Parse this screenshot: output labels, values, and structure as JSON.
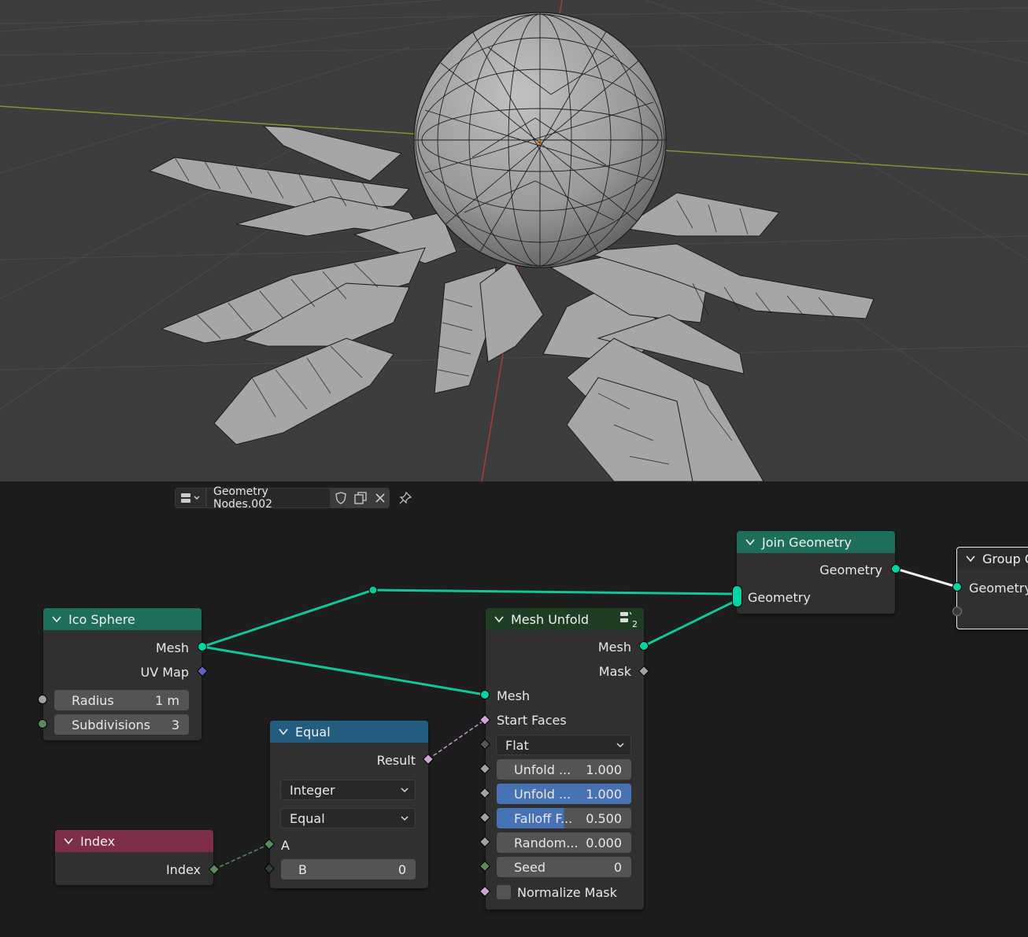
{
  "viewport": {
    "colors": {
      "background": "#3d3d3d",
      "mesh_fill": "#9b9b9b",
      "mesh_edge": "#1a1a1a",
      "x_axis": "#7a9a2a",
      "y_axis": "#a83a3a",
      "origin": "#e07a10"
    }
  },
  "header": {
    "editor_type_icon": "node-tree-icon",
    "tree_name": "Geometry Nodes.002"
  },
  "nodes": {
    "ico_sphere": {
      "title": "Ico Sphere",
      "outputs": [
        "Mesh",
        "UV Map"
      ],
      "radius_label": "Radius",
      "radius_value": "1 m",
      "subdivisions_label": "Subdivisions",
      "subdivisions_value": "3"
    },
    "join_geometry": {
      "title": "Join Geometry",
      "output_label": "Geometry",
      "input_label": "Geometry"
    },
    "group_output": {
      "title": "Group O",
      "input_label": "Geometry"
    },
    "mesh_unfold": {
      "title": "Mesh Unfold",
      "user_count": "2",
      "outputs": [
        "Mesh",
        "Mask"
      ],
      "mesh_input": "Mesh",
      "start_faces": "Start Faces",
      "method": "Flat",
      "fields": [
        {
          "label": "Unfold ...",
          "value": "1.000"
        },
        {
          "label": "Unfold ...",
          "value": "1.000"
        },
        {
          "label": "Falloff F...",
          "value": "0.500"
        },
        {
          "label": "Random...",
          "value": "0.000"
        },
        {
          "label": "Seed",
          "value": "0"
        }
      ],
      "normalize_label": "Normalize Mask"
    },
    "equal": {
      "title": "Equal",
      "output": "Result",
      "data_type": "Integer",
      "operation": "Equal",
      "a_label": "A",
      "b_label": "B",
      "b_value": "0"
    },
    "index": {
      "title": "Index",
      "output": "Index"
    }
  },
  "colors": {
    "geometry_socket": "#00d6a3",
    "geometry_header": "#1e6e5c",
    "utility_header": "#255d80",
    "input_header": "#7e2e46",
    "mesh_header": "#1f3d23",
    "selected_field": "#4772b3"
  }
}
